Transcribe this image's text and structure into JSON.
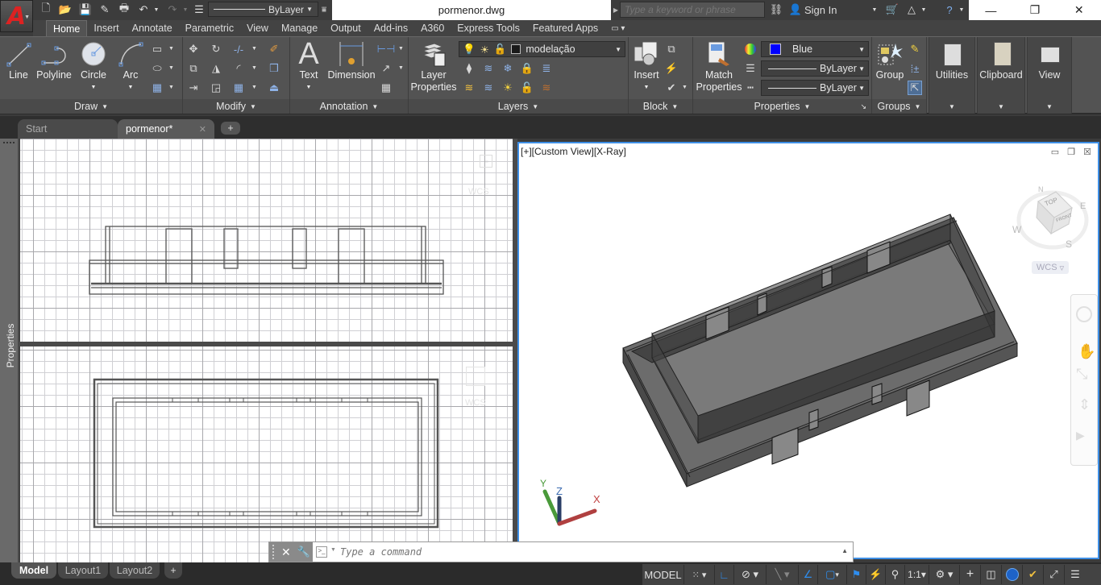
{
  "app": {
    "logo_letter": "A",
    "document_title": "pormenor.dwg"
  },
  "quick_access": {
    "icons": [
      "new-icon",
      "open-icon",
      "save-icon",
      "save-as-icon",
      "plot-icon",
      "undo-icon",
      "redo-icon",
      "workspace-icon"
    ],
    "linetype_value": "ByLayer"
  },
  "infocenter": {
    "search_placeholder": "Type a keyword or phrase",
    "sign_in_label": "Sign In"
  },
  "window_controls": {
    "minimize": "—",
    "restore": "❐",
    "close": "✕"
  },
  "ribbon_tabs": [
    "Home",
    "Insert",
    "Annotate",
    "Parametric",
    "View",
    "Manage",
    "Output",
    "Add-ins",
    "A360",
    "Express Tools",
    "Featured Apps"
  ],
  "active_ribbon_tab": "Home",
  "panels": {
    "draw": {
      "title": "Draw",
      "buttons": [
        "Line",
        "Polyline",
        "Circle",
        "Arc"
      ]
    },
    "modify": {
      "title": "Modify"
    },
    "annotation": {
      "title": "Annotation",
      "buttons": [
        "Text",
        "Dimension"
      ]
    },
    "layers": {
      "title": "Layers",
      "layer_properties_line1": "Layer",
      "layer_properties_line2": "Properties",
      "current_layer": "modelação"
    },
    "block": {
      "title": "Block",
      "insert_label": "Insert"
    },
    "properties": {
      "title": "Properties",
      "match_line1": "Match",
      "match_line2": "Properties",
      "color_value": "Blue",
      "color_swatch": "#0000ff",
      "lineweight_value": "ByLayer",
      "linetype_value": "ByLayer"
    },
    "groups": {
      "title": "Groups",
      "group_label": "Group"
    },
    "utilities": {
      "title": "Utilities"
    },
    "clipboard": {
      "title": "Clipboard"
    },
    "view": {
      "title": "View"
    }
  },
  "doc_tabs": [
    {
      "label": "Start",
      "active": false
    },
    {
      "label": "pormenor*",
      "active": true
    }
  ],
  "left_palette": {
    "label": "Properties"
  },
  "viewport_3d": {
    "label": "[+][Custom View][X-Ray]",
    "viewcube": {
      "top": "TOP",
      "front": "FRONT",
      "n": "N",
      "e": "E",
      "s": "S",
      "w": "W",
      "wcs": "WCS"
    },
    "ucs": {
      "x": "X",
      "y": "Y",
      "z": "Z"
    }
  },
  "viewport_top": {
    "wcs": "WCS"
  },
  "viewport_bottom": {
    "wcs": "WCS"
  },
  "command_line": {
    "placeholder": "Type a command"
  },
  "layout_tabs": [
    {
      "label": "Model",
      "active": true
    },
    {
      "label": "Layout1",
      "active": false
    },
    {
      "label": "Layout2",
      "active": false
    }
  ],
  "status_bar": {
    "model_label": "MODEL",
    "scale": "1:1"
  }
}
